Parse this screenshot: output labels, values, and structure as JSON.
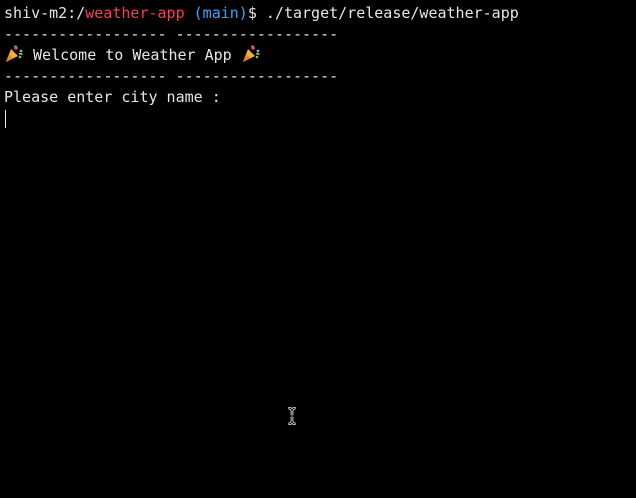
{
  "terminal": {
    "prompt": {
      "host": "shiv-m2:/",
      "directory": "weather-app",
      "branch": " (main)",
      "symbol": "$ ",
      "command": "./target/release/weather-app"
    },
    "separator_top": "------------------ ------------------",
    "welcome_text": " Welcome to Weather App ",
    "separator_bottom": "------------------ ------------------",
    "input_prompt": "Please enter city name :",
    "colors": {
      "background": "#000000",
      "text": "#e6e6e6",
      "directory": "#ff3b5a",
      "branch": "#3aa3ff"
    },
    "icons": {
      "welcome_left": "party-popper-icon",
      "welcome_right": "party-popper-icon",
      "mouse": "text-ibeam-cursor-icon"
    }
  }
}
